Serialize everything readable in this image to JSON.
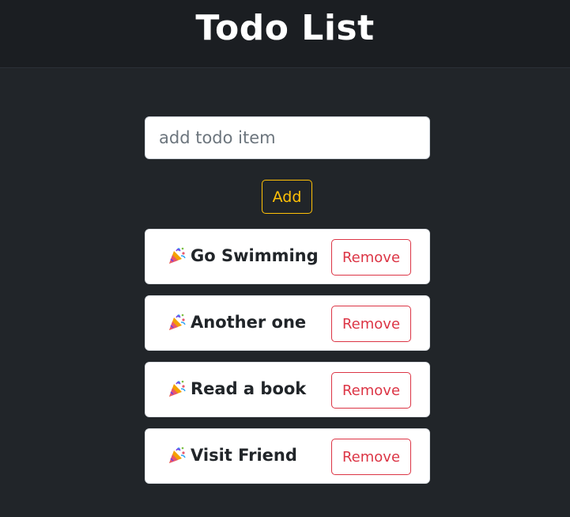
{
  "header": {
    "title": "Todo List"
  },
  "form": {
    "input_value": "",
    "input_placeholder": "add todo item",
    "add_label": "Add"
  },
  "todos": [
    {
      "icon": "party-popper-icon",
      "text": "Go Swimming",
      "remove_label": "Remove"
    },
    {
      "icon": "party-popper-icon",
      "text": "Another one",
      "remove_label": "Remove"
    },
    {
      "icon": "party-popper-icon",
      "text": "Read a book",
      "remove_label": "Remove"
    },
    {
      "icon": "party-popper-icon",
      "text": "Visit Friend",
      "remove_label": "Remove"
    }
  ],
  "colors": {
    "page_background": "#212529",
    "header_background": "#1b1e22",
    "add_button_accent": "#ffc107",
    "remove_button_accent": "#dc3545",
    "card_background": "#ffffff"
  }
}
